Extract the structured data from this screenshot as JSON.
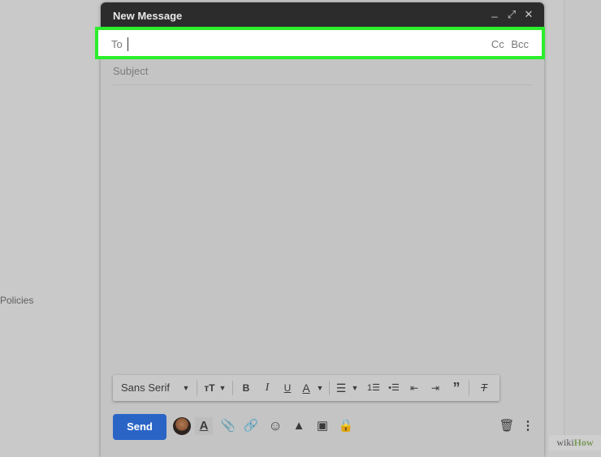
{
  "background": {
    "policies_label": "Policies"
  },
  "compose": {
    "title": "New Message",
    "controls": {
      "minimize": "_",
      "expand": "⤢",
      "close": "✕"
    },
    "to_label": "To",
    "cc_label": "Cc",
    "bcc_label": "Bcc",
    "subject_placeholder": "Subject"
  },
  "formatting": {
    "font_name": "Sans Serif",
    "icons": [
      "font-size-icon",
      "bold-icon",
      "italic-icon",
      "underline-icon",
      "text-color-icon",
      "align-icon",
      "numbered-list-icon",
      "bulleted-list-icon",
      "indent-less-icon",
      "indent-more-icon",
      "quote-icon",
      "remove-formatting-icon"
    ]
  },
  "footer": {
    "send_label": "Send"
  },
  "watermark": {
    "wiki": "wiki",
    "how": "How"
  },
  "colors": {
    "highlight": "#2bef2b",
    "send": "#2a65c6",
    "titlebar": "#2c2c2c"
  }
}
